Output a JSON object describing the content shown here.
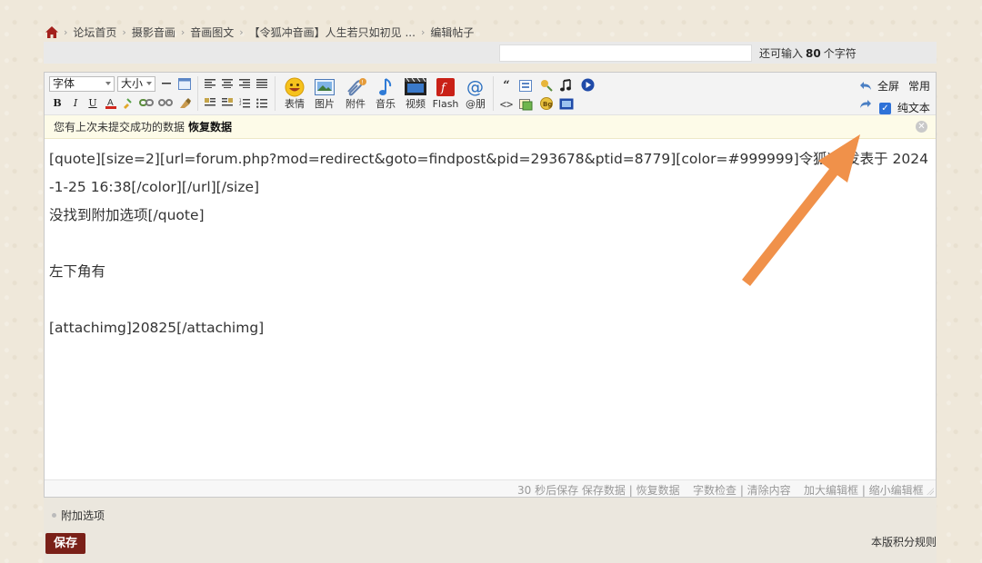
{
  "breadcrumb": {
    "items": [
      "论坛首页",
      "摄影音画",
      "音画图文",
      "【令狐冲音画】人生若只如初见 ...",
      "编辑帖子"
    ]
  },
  "title_bar": {
    "remain_prefix": "还可输入",
    "remain_count": "80",
    "remain_suffix": "个字符"
  },
  "toolbar": {
    "font_select": "字体",
    "size_select": "大小",
    "format_buttons": [
      "B",
      "I",
      "U"
    ],
    "big_buttons": [
      "表情",
      "图片",
      "附件",
      "音乐",
      "视频",
      "Flash",
      "@朋"
    ],
    "fullscreen": "全屏",
    "common": "常用",
    "plain_text": "纯文本",
    "plain_text_checked": true
  },
  "notice": {
    "text": "您有上次未提交成功的数据",
    "restore": "恢复数据"
  },
  "editor": {
    "content": "[quote][size=2][url=forum.php?mod=redirect&goto=findpost&pid=293678&ptid=8779][color=#999999]令狐冲 发表于 2024-1-25 16:38[/color][/url][/size]\n没找到附加选项[/quote]\n\n左下角有\n\n[attachimg]20825[/attachimg]"
  },
  "statusbar": {
    "autosave": "30 秒后保存 保存数据 | 恢复数据",
    "wordcheck": "字数检查 | 清除内容",
    "resize": "加大编辑框 | 缩小编辑框"
  },
  "extra": {
    "options": "附加选项"
  },
  "bottom": {
    "save": "保存",
    "rules": "本版积分规则"
  },
  "colors": {
    "annotation_arrow": "#f0914a",
    "save_button": "#7a2018",
    "home_icon": "#a3201c"
  }
}
